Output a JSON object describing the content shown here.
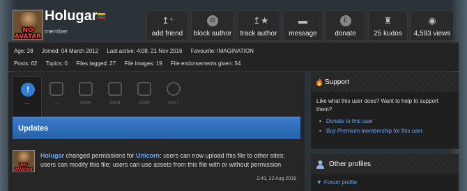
{
  "profile": {
    "username": "Holugar",
    "role": "member",
    "avatar": {
      "line1": "NO",
      "line2": "AVATAR"
    }
  },
  "actions": [
    {
      "label": "add friend",
      "icon": "add-friend-icon"
    },
    {
      "label": "block author",
      "icon": "block-icon"
    },
    {
      "label": "track author",
      "icon": "track-icon"
    },
    {
      "label": "message",
      "icon": "message-icon"
    },
    {
      "label": "donate",
      "icon": "pound-icon"
    },
    {
      "label": "25 kudos",
      "icon": "kudos-icon"
    },
    {
      "label": "4,593 views",
      "icon": "eye-icon"
    }
  ],
  "stats": {
    "row1": [
      "Age: 28",
      "Joined: 04 March 2012",
      "Last active: 4:08, 21 Nov 2016",
      "Favourite: IMAGINATION"
    ],
    "row2": [
      "Posts: 62",
      "Topics: 0",
      "Files tagged: 27",
      "File images: 19",
      "File endorsements given: 54"
    ]
  },
  "tabs": [
    {
      "count": "—",
      "icon": "updates-icon"
    },
    {
      "count": "—",
      "icon": "list-icon"
    },
    {
      "count": "0005",
      "icon": "folder-icon"
    },
    {
      "count": "0004",
      "icon": "image-icon"
    },
    {
      "count": "0000",
      "icon": "video-icon"
    },
    {
      "count": "0017",
      "icon": "user-icon"
    }
  ],
  "updates": {
    "title": "Updates",
    "entry": {
      "user": "Holugar",
      "text1": " changed permissions for ",
      "file": "Unicorn",
      "text2": ": users can now upload this file to other sites; users can modify this file; users can use assets from this file with or without permission",
      "date": "2:43, 22 Aug 2016"
    }
  },
  "support": {
    "title": "Support",
    "body": "Like what this user does? Want to help to support them?",
    "links": [
      "Donate to this user",
      "Buy Premium membership for this user"
    ]
  },
  "other_profiles": {
    "title": "Other profiles",
    "link": "Forum profile"
  }
}
